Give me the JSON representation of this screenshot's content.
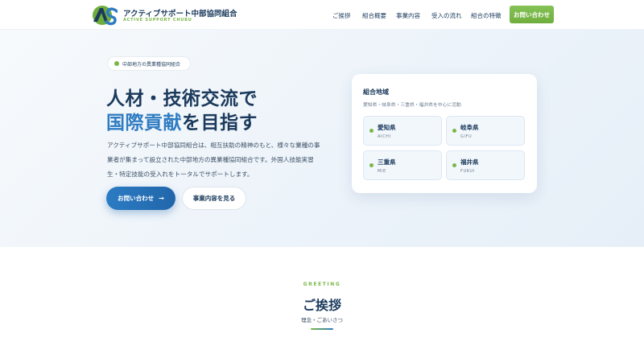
{
  "header": {
    "brand_jp": "アクティブサポート中部協同組合",
    "brand_en": "ACTIVE SUPPORT CHUBU",
    "nav": [
      "ご挨拶",
      "組合概要",
      "事業内容",
      "受入の流れ",
      "組合の特徴"
    ],
    "cta": "お問い合わせ"
  },
  "hero": {
    "tag": "中部地方の異業種協同組合",
    "title_line1": "人材・技術交流で",
    "title_line2_accent": "国際貢献",
    "title_line2_rest": "を目指す",
    "description": "アクティブサポート中部協同組合は、相互扶助の精神のもと、様々な業種の事業者が集まって設立された中部地方の異業種協同組合です。外国人技能実習生・特定技能の受入れをトータルでサポートします。",
    "primary_button": "お問い合わせ",
    "primary_arrow": "→",
    "secondary_button": "事業内容を見る"
  },
  "area_card": {
    "title": "組合地域",
    "subtitle": "愛知県・岐阜県・三重県・福井県を中心に活動",
    "prefectures": [
      {
        "name": "愛知県",
        "en": "AICHI"
      },
      {
        "name": "岐阜県",
        "en": "GIFU"
      },
      {
        "name": "三重県",
        "en": "MIE"
      },
      {
        "name": "福井県",
        "en": "FUKUI"
      }
    ]
  },
  "greeting": {
    "label_en": "GREETING",
    "title": "ご挨拶",
    "subtitle": "理念・ごあいさつ"
  },
  "colors": {
    "navy": "#1b3a5c",
    "accent_blue": "#2f7cc2",
    "accent_green": "#7ab648"
  },
  "icons": {
    "logo": "active-support-logo",
    "arrow": "arrow-right-icon"
  }
}
